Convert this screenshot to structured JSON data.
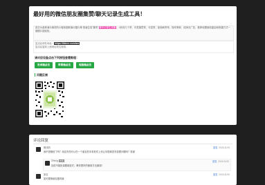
{
  "header": {
    "title": "最好用的微信朋友圈集赞/聊天记录生成工具！"
  },
  "intro": {
    "text_a": "进去为各种演示素材的小程序图和演示图片等.快速生成\"集赞\"",
    "highlight": "聊天记录生成器",
    "text_b": "，1秒钟几个赞，可发随意赞，可发赞，拒绝刷赞号。操作简单，纯净无广告，推荐收藏使用重启和快捷方式一键图片能轻松。"
  },
  "url_box": {
    "line1_prefix": "复活后请在地址：",
    "url": "https://fakee.com/wx",
    "line2": "复活后复制上面地址前往使用。"
  },
  "select_label": "请对应设备点击下列按钮查看教程：",
  "buttons": {
    "wechat_mini": "安卓端点击",
    "ios": "苹果端点击",
    "pc": "电脑端点击"
  },
  "qr_section": {
    "title": "问题反馈"
  },
  "comments": {
    "title": "评论回复",
    "items": [
      {
        "user": "搁浅的",
        "badge": "",
        "text": "我不是微信了吗？用这东西可以在一个朋友的手机软件上传让你视频发布查看问题吗？感谢",
        "action": "回复",
        "time": "2021/11/19"
      },
      {
        "user": "ZHeng",
        "badge": "作者",
        "text": "目前不能批量跟朋友们，教你更好的使用方法谢谢！",
        "action": "回复",
        "time": "2021/11/22"
      },
      {
        "user": "某名",
        "badge": "",
        "text": "如何更换朋友圈背景",
        "action": "回复",
        "time": "2021/11/20"
      }
    ]
  },
  "colors": {
    "page_bg": "#1f1f1f",
    "button_green": "#27a844",
    "highlight_pink": "#ee44aa",
    "link_blue": "#3a7ad6"
  }
}
